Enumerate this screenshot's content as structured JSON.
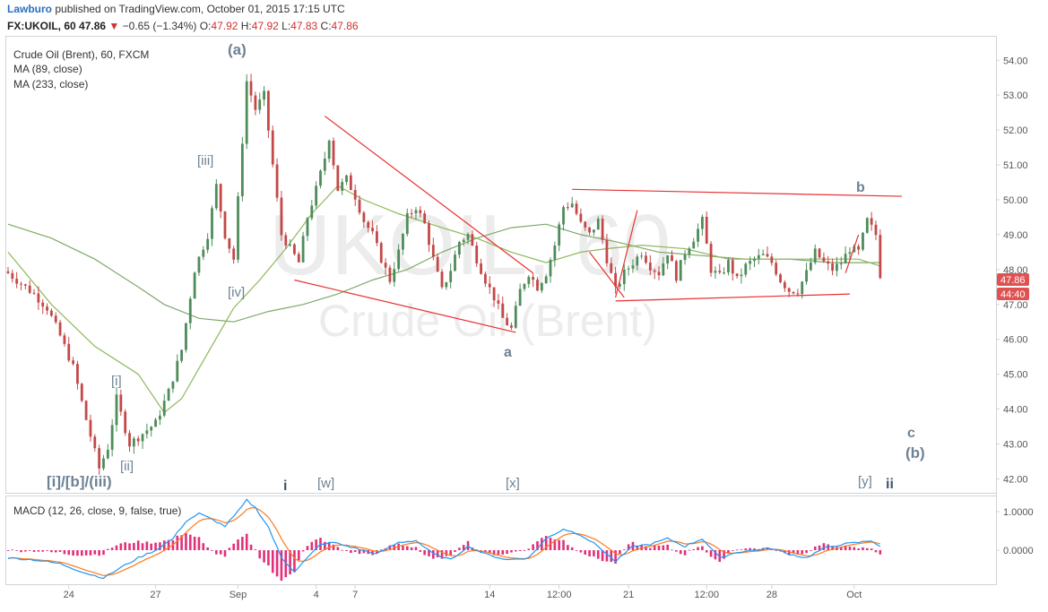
{
  "header": {
    "author": "Lawburo",
    "published_text": "published on TradingView.com, October 01, 2015 17:15 UTC",
    "symbol": "FX:UKOIL, 60",
    "last": "47.86",
    "change_arrow": "▼",
    "change": "−0.65 (−1.34%)",
    "o_label": "O:",
    "o_value": "47.92",
    "h_label": "H:",
    "h_value": "47.92",
    "l_label": "L:",
    "l_value": "47.83",
    "c_label": "C:",
    "c_value": "47.86"
  },
  "legend": {
    "title": "Crude Oil (Brent), 60, FXCM",
    "ma1": "MA (89, close)",
    "ma2": "MA (233, close)"
  },
  "watermark": {
    "big": "UKOIL, 60",
    "small": "Crude Oil (Brent)"
  },
  "price_tags": {
    "last": "47.86",
    "countdown": "44:40"
  },
  "macd": {
    "label": "MACD (12, 26, close, 9, false, true)",
    "ticks": [
      "1.0000",
      "0.0000"
    ]
  },
  "xaxis": {
    "labels": [
      "24",
      "27",
      "Sep",
      "4",
      "7",
      "14",
      "12:00",
      "21",
      "12:00",
      "28",
      "Oct"
    ]
  },
  "wave_labels": {
    "a_paren": "(a)",
    "iii_br": "[iii]",
    "iv_br": "[iv]",
    "i_br": "[i]",
    "ii_br": "[ii]",
    "big_combo": "[i]/[b]/(iii)",
    "i": "i",
    "w_br": "[w]",
    "x_br": "[x]",
    "a": "a",
    "b": "b",
    "y_br": "[y]",
    "ii": "ii",
    "c": "c",
    "b_paren": "(b)"
  },
  "colors": {
    "up": "#4e8c5a",
    "down": "#c44848",
    "ma89": "#8db85b",
    "ma233": "#7ea86a",
    "trend": "#e83030",
    "macd": "#2196f3",
    "signal": "#ff7a1a",
    "hist_pos": "#e0307a",
    "label": "#6d8294"
  },
  "chart_data": [
    {
      "type": "candlestick",
      "title": "Crude Oil (Brent), 60, FXCM",
      "ylim": [
        41.6,
        54.7
      ],
      "yticks": [
        42,
        43,
        44,
        45,
        46,
        47,
        48,
        49,
        50,
        51,
        52,
        53,
        54
      ],
      "anchors_close": [
        [
          0,
          47.9
        ],
        [
          3,
          47.6
        ],
        [
          6,
          47.3
        ],
        [
          9,
          46.9
        ],
        [
          12,
          46.1
        ],
        [
          15,
          45.2
        ],
        [
          18,
          43.7
        ],
        [
          21,
          42.3
        ],
        [
          23,
          42.9
        ],
        [
          25,
          44.3
        ],
        [
          28,
          43.0
        ],
        [
          31,
          43.3
        ],
        [
          34,
          43.6
        ],
        [
          37,
          44.5
        ],
        [
          40,
          45.7
        ],
        [
          43,
          48.0
        ],
        [
          46,
          49.0
        ],
        [
          48,
          50.4
        ],
        [
          50,
          49.0
        ],
        [
          52,
          48.3
        ],
        [
          53,
          50.0
        ],
        [
          55,
          53.4
        ],
        [
          57,
          52.6
        ],
        [
          59,
          53.0
        ],
        [
          61,
          51.0
        ],
        [
          63,
          49.0
        ],
        [
          65,
          48.6
        ],
        [
          67,
          48.2
        ],
        [
          69,
          49.5
        ],
        [
          71,
          50.3
        ],
        [
          73,
          51.2
        ],
        [
          74,
          51.8
        ],
        [
          76,
          50.3
        ],
        [
          78,
          50.6
        ],
        [
          80,
          50.1
        ],
        [
          82,
          49.4
        ],
        [
          84,
          49.0
        ],
        [
          86,
          48.3
        ],
        [
          88,
          47.7
        ],
        [
          90,
          48.5
        ],
        [
          92,
          49.5
        ],
        [
          94,
          49.8
        ],
        [
          96,
          49.3
        ],
        [
          98,
          48.3
        ],
        [
          100,
          47.4
        ],
        [
          102,
          48.0
        ],
        [
          104,
          48.8
        ],
        [
          106,
          49.0
        ],
        [
          108,
          48.3
        ],
        [
          110,
          47.7
        ],
        [
          112,
          47.2
        ],
        [
          114,
          46.6
        ],
        [
          116,
          46.3
        ],
        [
          118,
          47.4
        ],
        [
          120,
          47.9
        ],
        [
          122,
          47.5
        ],
        [
          124,
          47.9
        ],
        [
          126,
          48.7
        ],
        [
          128,
          49.8
        ],
        [
          130,
          49.9
        ],
        [
          132,
          49.3
        ],
        [
          134,
          49.0
        ],
        [
          136,
          49.4
        ],
        [
          138,
          48.3
        ],
        [
          140,
          47.4
        ],
        [
          142,
          47.9
        ],
        [
          144,
          48.2
        ],
        [
          146,
          48.5
        ],
        [
          148,
          48.1
        ],
        [
          150,
          47.9
        ],
        [
          152,
          48.5
        ],
        [
          154,
          47.8
        ],
        [
          156,
          48.5
        ],
        [
          158,
          48.9
        ],
        [
          160,
          49.4
        ],
        [
          162,
          48.0
        ],
        [
          164,
          47.8
        ],
        [
          166,
          48.2
        ],
        [
          168,
          47.7
        ],
        [
          170,
          48.1
        ],
        [
          172,
          48.3
        ],
        [
          174,
          48.4
        ],
        [
          176,
          48.2
        ],
        [
          178,
          47.7
        ],
        [
          180,
          47.4
        ],
        [
          182,
          47.4
        ],
        [
          184,
          47.9
        ],
        [
          186,
          48.5
        ],
        [
          188,
          48.2
        ],
        [
          190,
          48.0
        ],
        [
          192,
          48.2
        ],
        [
          194,
          48.6
        ],
        [
          196,
          48.5
        ],
        [
          198,
          49.4
        ],
        [
          200,
          49.0
        ],
        [
          201,
          47.86
        ]
      ],
      "ma89_points": [
        [
          0,
          48.5
        ],
        [
          10,
          47.0
        ],
        [
          20,
          45.8
        ],
        [
          30,
          45.0
        ],
        [
          36,
          43.9
        ],
        [
          40,
          44.3
        ],
        [
          46,
          45.6
        ],
        [
          52,
          46.9
        ],
        [
          58,
          47.7
        ],
        [
          64,
          48.6
        ],
        [
          70,
          49.6
        ],
        [
          76,
          50.4
        ],
        [
          82,
          50.0
        ],
        [
          90,
          49.6
        ],
        [
          100,
          49.2
        ],
        [
          108,
          48.9
        ],
        [
          116,
          48.5
        ],
        [
          124,
          48.2
        ],
        [
          132,
          48.5
        ],
        [
          138,
          48.6
        ],
        [
          146,
          48.7
        ],
        [
          156,
          48.6
        ],
        [
          166,
          48.3
        ],
        [
          176,
          48.3
        ],
        [
          186,
          48.3
        ],
        [
          196,
          48.3
        ],
        [
          201,
          48.1
        ]
      ],
      "ma233_points": [
        [
          0,
          49.3
        ],
        [
          10,
          48.9
        ],
        [
          20,
          48.3
        ],
        [
          30,
          47.5
        ],
        [
          36,
          47.0
        ],
        [
          44,
          46.6
        ],
        [
          52,
          46.5
        ],
        [
          60,
          46.8
        ],
        [
          68,
          47.0
        ],
        [
          76,
          47.3
        ],
        [
          84,
          47.7
        ],
        [
          92,
          48.0
        ],
        [
          100,
          48.5
        ],
        [
          108,
          48.9
        ],
        [
          116,
          49.2
        ],
        [
          124,
          49.3
        ],
        [
          132,
          49.0
        ],
        [
          140,
          48.8
        ],
        [
          150,
          48.5
        ],
        [
          160,
          48.4
        ],
        [
          170,
          48.3
        ],
        [
          180,
          48.3
        ],
        [
          190,
          48.2
        ],
        [
          201,
          48.2
        ]
      ],
      "trendlines": [
        {
          "from": [
            73,
            52.4
          ],
          "to": [
            121,
            47.9
          ]
        },
        {
          "from": [
            66,
            47.7
          ],
          "to": [
            117,
            46.2
          ]
        },
        {
          "from": [
            130,
            50.3
          ],
          "to": [
            206,
            50.1
          ]
        },
        {
          "from": [
            140,
            47.1
          ],
          "to": [
            194,
            47.3
          ]
        },
        {
          "from": [
            134,
            48.5
          ],
          "to": [
            142,
            47.2
          ]
        },
        {
          "from": [
            140,
            47.2
          ],
          "to": [
            145,
            49.7
          ]
        },
        {
          "from": [
            193,
            47.9
          ],
          "to": [
            196,
            49.0
          ]
        }
      ]
    },
    {
      "type": "line",
      "title": "MACD (12, 26, close, 9, false, true)",
      "ylim": [
        -1.0,
        1.35
      ],
      "yticks": [
        1.0,
        0.0
      ],
      "macd_anchors": [
        [
          0,
          -0.2
        ],
        [
          6,
          -0.25
        ],
        [
          12,
          -0.35
        ],
        [
          18,
          -0.6
        ],
        [
          22,
          -0.72
        ],
        [
          26,
          -0.45
        ],
        [
          30,
          -0.2
        ],
        [
          34,
          0.0
        ],
        [
          38,
          0.3
        ],
        [
          41,
          0.75
        ],
        [
          44,
          0.95
        ],
        [
          47,
          0.8
        ],
        [
          50,
          0.62
        ],
        [
          53,
          1.0
        ],
        [
          55,
          1.3
        ],
        [
          57,
          1.1
        ],
        [
          60,
          0.6
        ],
        [
          63,
          -0.2
        ],
        [
          66,
          -0.55
        ],
        [
          69,
          -0.2
        ],
        [
          72,
          0.15
        ],
        [
          75,
          0.2
        ],
        [
          80,
          0.05
        ],
        [
          85,
          -0.1
        ],
        [
          90,
          0.2
        ],
        [
          94,
          0.25
        ],
        [
          98,
          -0.1
        ],
        [
          102,
          -0.25
        ],
        [
          106,
          0.1
        ],
        [
          110,
          -0.1
        ],
        [
          115,
          -0.25
        ],
        [
          120,
          -0.2
        ],
        [
          124,
          0.3
        ],
        [
          128,
          0.55
        ],
        [
          132,
          0.4
        ],
        [
          136,
          0.1
        ],
        [
          140,
          -0.3
        ],
        [
          144,
          0.1
        ],
        [
          148,
          0.15
        ],
        [
          152,
          0.3
        ],
        [
          156,
          0.1
        ],
        [
          160,
          0.3
        ],
        [
          164,
          -0.2
        ],
        [
          168,
          -0.05
        ],
        [
          172,
          0.0
        ],
        [
          176,
          0.05
        ],
        [
          180,
          -0.1
        ],
        [
          184,
          -0.2
        ],
        [
          188,
          0.05
        ],
        [
          192,
          0.15
        ],
        [
          196,
          0.2
        ],
        [
          199,
          0.25
        ],
        [
          201,
          0.1
        ]
      ]
    }
  ]
}
